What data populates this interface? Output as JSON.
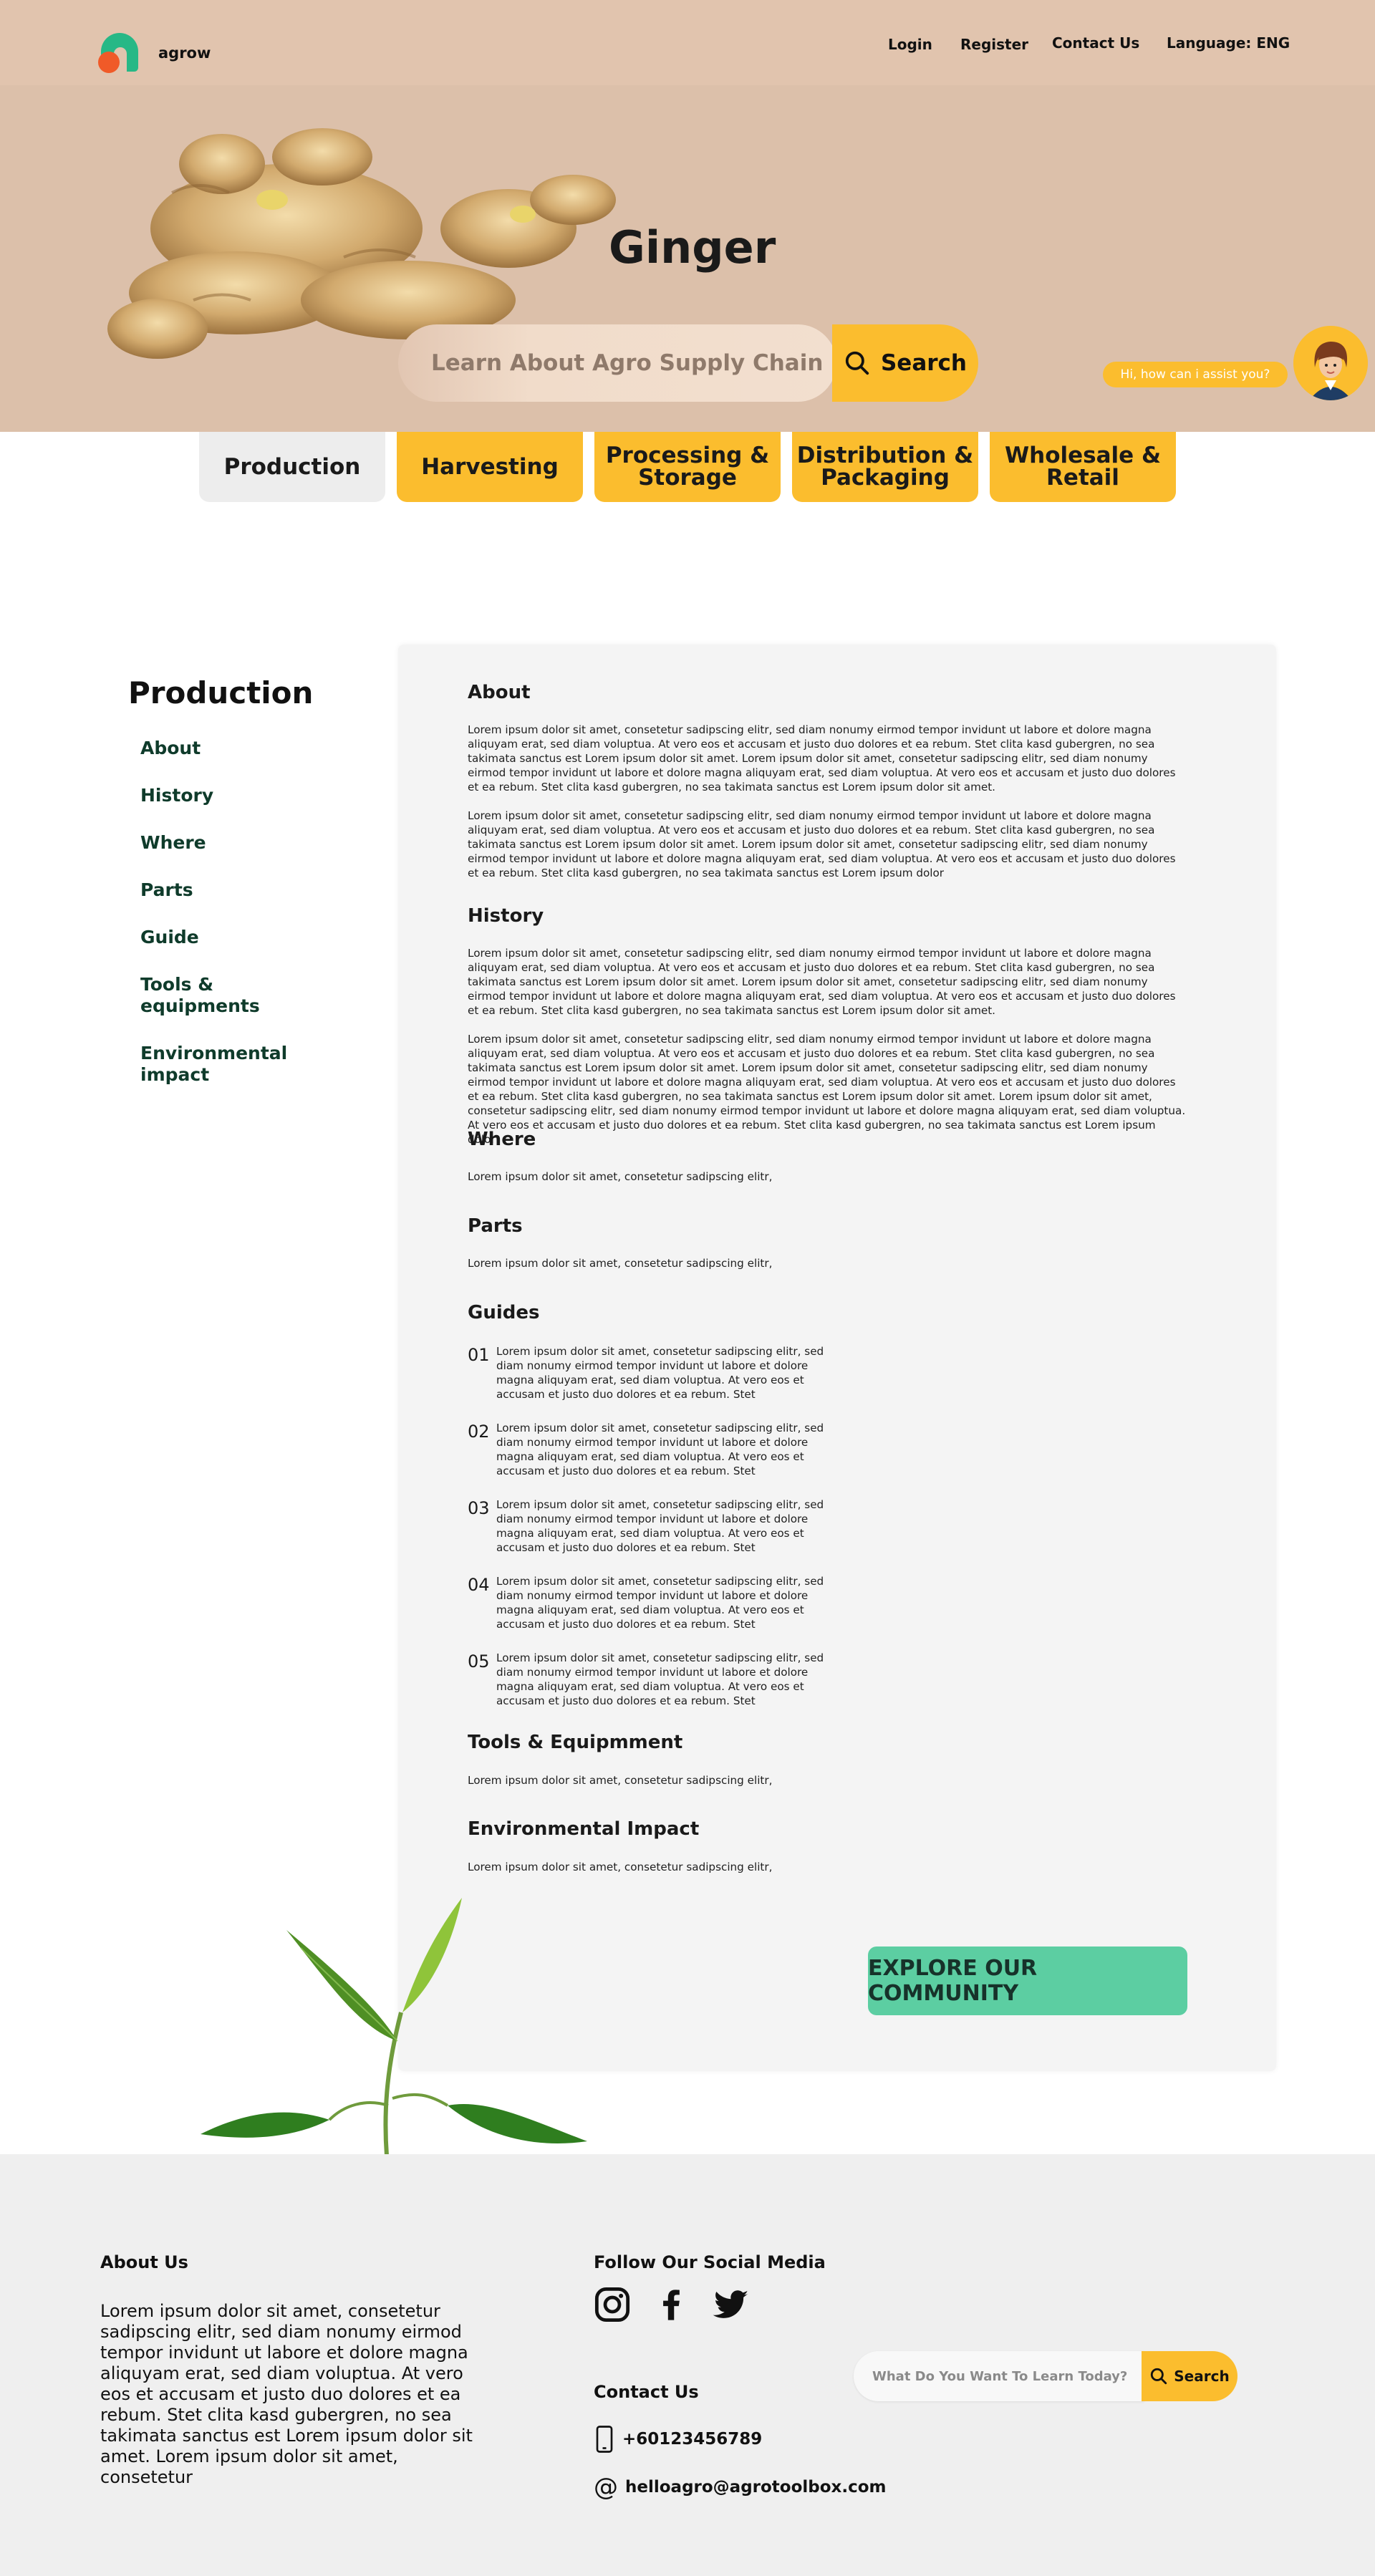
{
  "header": {
    "brand": "agrow",
    "nav": [
      {
        "label": "Login"
      },
      {
        "label": "Register"
      },
      {
        "label": "Contact Us"
      },
      {
        "label": "Language: ENG"
      }
    ]
  },
  "hero": {
    "title": "Ginger",
    "search_placeholder": "Learn About Agro Supply Chain",
    "search_button": "Search",
    "assistant_prompt": "Hi, how can i assist you?"
  },
  "tabs": [
    {
      "label": "Production",
      "active": true
    },
    {
      "label": "Harvesting",
      "active": false
    },
    {
      "label": "Processing & Storage",
      "active": false
    },
    {
      "label": "Distribution & Packaging",
      "active": false
    },
    {
      "label": "Wholesale & Retail",
      "active": false
    }
  ],
  "sidebar": {
    "title": "Production",
    "items": [
      {
        "label": "About"
      },
      {
        "label": "History"
      },
      {
        "label": "Where"
      },
      {
        "label": "Parts"
      },
      {
        "label": "Guide"
      },
      {
        "label": "Tools & equipments"
      },
      {
        "label": "Environmental impact"
      }
    ]
  },
  "content": {
    "about": {
      "heading": "About",
      "paragraphs": [
        "Lorem ipsum dolor sit amet, consetetur sadipscing elitr, sed diam nonumy eirmod tempor invidunt ut labore et dolore magna aliquyam erat, sed diam voluptua. At vero eos et accusam et justo duo dolores et ea rebum. Stet clita kasd gubergren, no sea takimata sanctus est Lorem ipsum dolor sit amet. Lorem ipsum dolor sit amet, consetetur sadipscing elitr, sed diam nonumy eirmod tempor invidunt ut labore et dolore magna aliquyam erat, sed diam voluptua. At vero eos et accusam et justo duo dolores et ea rebum. Stet clita kasd gubergren, no sea takimata sanctus est Lorem ipsum dolor sit amet.",
        "Lorem ipsum dolor sit amet, consetetur sadipscing elitr, sed diam nonumy eirmod tempor invidunt ut labore et dolore magna aliquyam erat, sed diam voluptua. At vero eos et accusam et justo duo dolores et ea rebum. Stet clita kasd gubergren, no sea takimata sanctus est Lorem ipsum dolor sit amet. Lorem ipsum dolor sit amet, consetetur sadipscing elitr, sed diam nonumy eirmod tempor invidunt ut labore et dolore magna aliquyam erat, sed diam voluptua. At vero eos et accusam et justo duo dolores et ea rebum. Stet clita kasd gubergren, no sea takimata sanctus est Lorem ipsum dolor"
      ]
    },
    "history": {
      "heading": "History",
      "paragraphs": [
        "Lorem ipsum dolor sit amet, consetetur sadipscing elitr, sed diam nonumy eirmod tempor invidunt ut labore et dolore magna aliquyam erat, sed diam voluptua. At vero eos et accusam et justo duo dolores et ea rebum. Stet clita kasd gubergren, no sea takimata sanctus est Lorem ipsum dolor sit amet. Lorem ipsum dolor sit amet, consetetur sadipscing elitr, sed diam nonumy eirmod tempor invidunt ut labore et dolore magna aliquyam erat, sed diam voluptua. At vero eos et accusam et justo duo dolores et ea rebum. Stet clita kasd gubergren, no sea takimata sanctus est Lorem ipsum dolor sit amet.",
        "Lorem ipsum dolor sit amet, consetetur sadipscing elitr, sed diam nonumy eirmod tempor invidunt ut labore et dolore magna aliquyam erat, sed diam voluptua. At vero eos et accusam et justo duo dolores et ea rebum. Stet clita kasd gubergren, no sea takimata sanctus est Lorem ipsum dolor sit amet. Lorem ipsum dolor sit amet, consetetur sadipscing elitr, sed diam nonumy eirmod tempor invidunt ut labore et dolore magna aliquyam erat, sed diam voluptua. At vero eos et accusam et justo duo dolores et ea rebum. Stet clita kasd gubergren, no sea takimata sanctus est Lorem ipsum dolor sit amet. Lorem ipsum dolor sit amet, consetetur sadipscing elitr, sed diam nonumy eirmod tempor invidunt ut labore et dolore magna aliquyam erat, sed diam voluptua. At vero eos et accusam et justo duo dolores et ea rebum. Stet clita kasd gubergren, no sea takimata sanctus est Lorem ipsum dolor"
      ]
    },
    "where": {
      "heading": "Where",
      "text": "Lorem ipsum dolor sit amet, consetetur sadipscing elitr,"
    },
    "parts": {
      "heading": "Parts",
      "text": "Lorem ipsum dolor sit amet, consetetur sadipscing elitr,"
    },
    "guides": {
      "heading": "Guides",
      "items": [
        {
          "num": "01",
          "text": "Lorem ipsum dolor sit amet, consetetur sadipscing elitr, sed diam nonumy eirmod tempor invidunt ut labore et dolore magna aliquyam erat, sed diam voluptua. At vero eos et accusam et justo duo dolores et ea rebum. Stet"
        },
        {
          "num": "02",
          "text": "Lorem ipsum dolor sit amet, consetetur sadipscing elitr, sed diam nonumy eirmod tempor invidunt ut labore et dolore magna aliquyam erat, sed diam voluptua. At vero eos et accusam et justo duo dolores et ea rebum. Stet"
        },
        {
          "num": "03",
          "text": "Lorem ipsum dolor sit amet, consetetur sadipscing elitr, sed diam nonumy eirmod tempor invidunt ut labore et dolore magna aliquyam erat, sed diam voluptua. At vero eos et accusam et justo duo dolores et ea rebum. Stet"
        },
        {
          "num": "04",
          "text": "Lorem ipsum dolor sit amet, consetetur sadipscing elitr, sed diam nonumy eirmod tempor invidunt ut labore et dolore magna aliquyam erat, sed diam voluptua. At vero eos et accusam et justo duo dolores et ea rebum. Stet"
        },
        {
          "num": "05",
          "text": "Lorem ipsum dolor sit amet, consetetur sadipscing elitr, sed diam nonumy eirmod tempor invidunt ut labore et dolore magna aliquyam erat, sed diam voluptua. At vero eos et accusam et justo duo dolores et ea rebum. Stet"
        }
      ]
    },
    "tools": {
      "heading": "Tools & Equipmment",
      "text": "Lorem ipsum dolor sit amet, consetetur sadipscing elitr,"
    },
    "environment": {
      "heading": "Environmental Impact",
      "text": "Lorem ipsum dolor sit amet, consetetur sadipscing elitr,"
    },
    "cta": "EXPLORE OUR COMMUNITY"
  },
  "footer": {
    "about_heading": "About Us",
    "about_text": "Lorem ipsum dolor sit amet, consetetur sadipscing elitr, sed diam nonumy eirmod tempor invidunt ut labore et dolore magna aliquyam erat, sed diam voluptua. At vero eos et accusam et justo duo dolores et ea rebum. Stet clita kasd gubergren, no sea takimata sanctus est Lorem ipsum dolor sit amet. Lorem ipsum dolor sit amet, consetetur",
    "social_heading": "Follow Our Social Media",
    "social_icons": [
      "instagram-icon",
      "facebook-icon",
      "twitter-icon"
    ],
    "contact_heading": "Contact Us",
    "phone": "+60123456789",
    "email": "helloagro@agrotoolbox.com",
    "search_placeholder": "What Do You Want To Learn Today?",
    "search_button": "Search"
  },
  "colors": {
    "header_bg": "#e1c4ae",
    "hero_bg": "#dcc0aa",
    "accent_yellow": "#fbbd2e",
    "accent_green": "#5ccea2",
    "logo_green": "#27b886",
    "logo_orange": "#f05a28",
    "footer_bg": "#efefef"
  }
}
